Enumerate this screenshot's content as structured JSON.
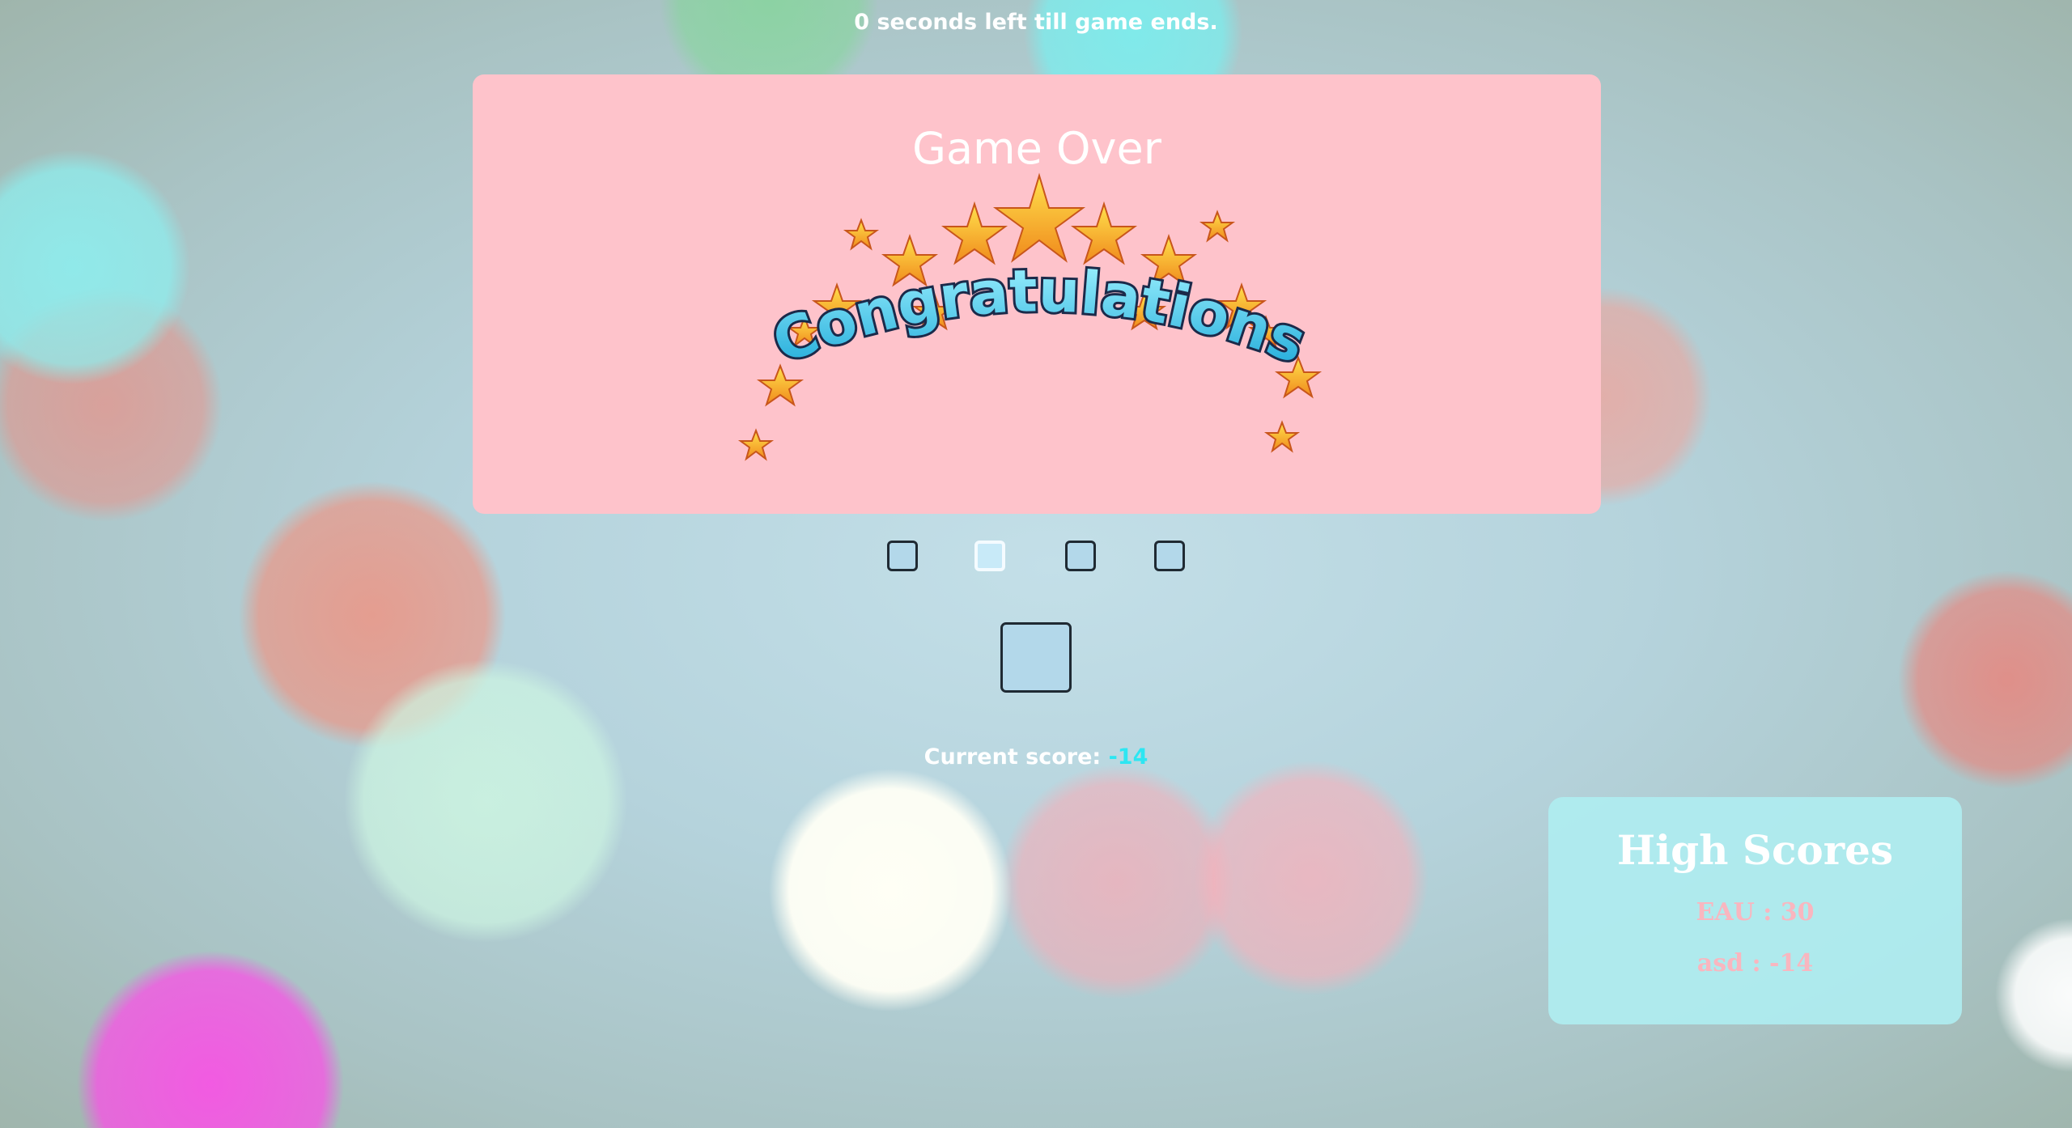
{
  "timer": {
    "text": "0 seconds left till game ends."
  },
  "gameover": {
    "title": "Game Over",
    "banner_text": "Congratulations"
  },
  "score": {
    "label": "Current score:",
    "value": "-14"
  },
  "high_scores": {
    "title": "High Scores",
    "entries": [
      {
        "text": "EAU : 30"
      },
      {
        "text": "asd : -14"
      }
    ]
  },
  "colors": {
    "panel_pink": "#fec3cb",
    "square_fill": "#b3d8ea",
    "score_accent": "#2de6f2",
    "high_score_panel": "#afedf0",
    "high_score_entry": "#f9b6bf"
  }
}
